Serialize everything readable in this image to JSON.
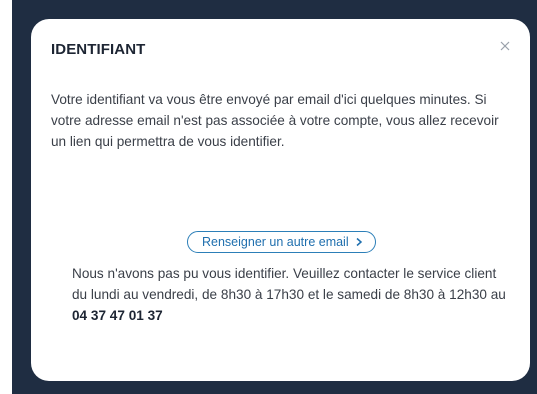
{
  "modal": {
    "title": "IDENTIFIANT",
    "close_icon": "close-icon",
    "message": "Votre identifiant va vous être envoyé par email d'ici quelques minutes. Si votre adresse email n'est pas associée à votre compte, vous allez recevoir un lien qui permettra de vous identifier.",
    "link_label": "Renseigner un autre email",
    "link_icon": "chevron-right-icon",
    "error_text": "Nous n'avons pas pu vous identifier. Veuillez contacter le service client du lundi au vendredi, de 8h30 à 17h30 et le samedi de 8h30 à 12h30 au ",
    "phone": "04 37 47 01 37"
  },
  "colors": {
    "backdrop": "#1f2d42",
    "link": "#1f6fae",
    "text": "#3a3f48"
  }
}
